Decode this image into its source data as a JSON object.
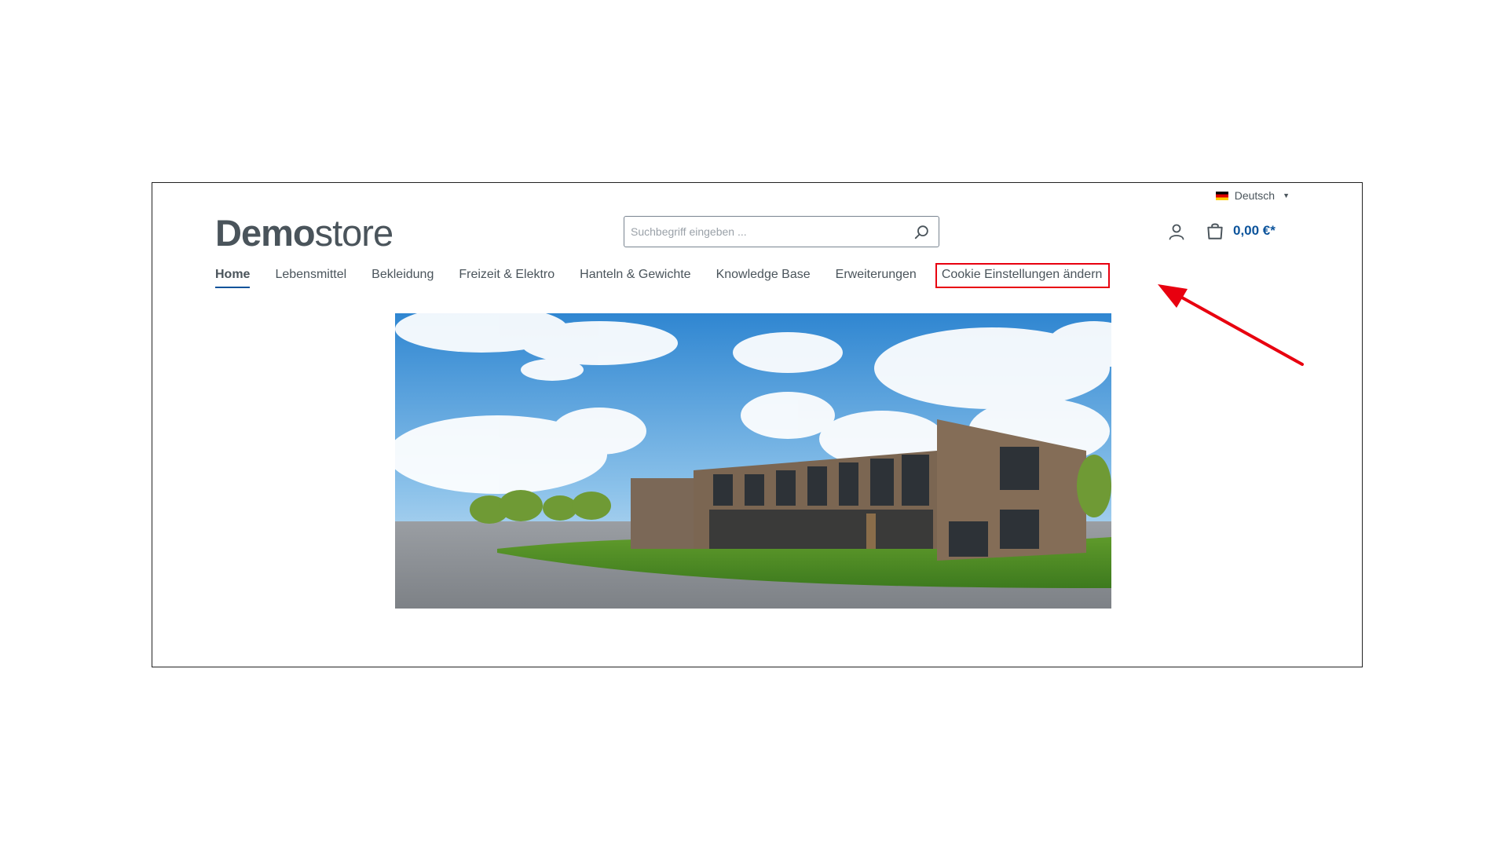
{
  "header": {
    "language": "Deutsch",
    "logo": {
      "bold": "Demo",
      "light": "store"
    },
    "search": {
      "placeholder": "Suchbegriff eingeben ..."
    },
    "cart_total": "0,00 €*"
  },
  "nav": {
    "items": [
      {
        "label": "Home",
        "active": true
      },
      {
        "label": "Lebensmittel"
      },
      {
        "label": "Bekleidung"
      },
      {
        "label": "Freizeit & Elektro"
      },
      {
        "label": "Hanteln & Gewichte"
      },
      {
        "label": "Knowledge Base"
      },
      {
        "label": "Erweiterungen"
      },
      {
        "label": "Cookie Einstellungen ändern",
        "highlighted": true
      }
    ]
  },
  "colors": {
    "accent": "#0b539b",
    "annotation": "#e8000f",
    "text": "#4a545b"
  },
  "icons": [
    "flag-de-icon",
    "caret-down-icon",
    "search-icon",
    "user-icon",
    "cart-bag-icon",
    "annotation-arrow-icon"
  ]
}
